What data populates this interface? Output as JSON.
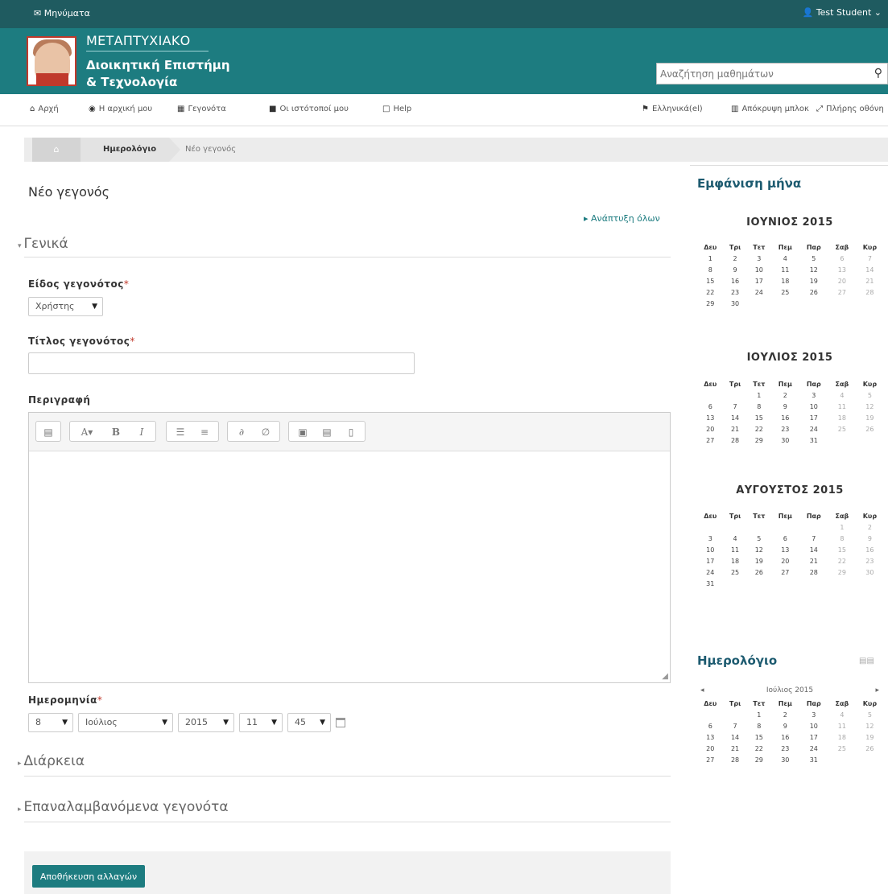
{
  "topbar": {
    "messages": "Μηνύματα",
    "user": "Test Student"
  },
  "header": {
    "line1": "ΜΕΤΑΠΤΥΧΙΑΚΟ",
    "line2": "Διοικητική Επιστήμη",
    "line3": "& Τεχνολογία",
    "search_placeholder": "Αναζήτηση μαθημάτων"
  },
  "nav": {
    "home": "Αρχή",
    "dashboard": "Η αρχική μου",
    "events": "Γεγονότα",
    "my_sites": "Οι ιστότοποί μου",
    "help": "Help",
    "language": "Ελληνικά(el)",
    "hide_blocks": "Απόκρυψη μπλοκ",
    "fullscreen": "Πλήρης οθόνη"
  },
  "breadcrumb": {
    "calendar": "Ημερολόγιο",
    "current": "Νέο γεγονός"
  },
  "main": {
    "title": "Νέο γεγονός",
    "expand_all": "Ανάπτυξη όλων",
    "general": "Γενικά",
    "event_type_label": "Είδος γεγονότος",
    "event_type_value": "Χρήστης",
    "event_title_label": "Τίτλος γεγονότος",
    "description_label": "Περιγραφή",
    "date_label": "Ημερομηνία",
    "duration": "Διάρκεια",
    "repeat": "Επαναλαμβανόμενα γεγονότα",
    "save": "Αποθήκευση αλλαγών",
    "required_mark": "*"
  },
  "date": {
    "day": "8",
    "month": "Ιούλιος",
    "year": "2015",
    "hour": "11",
    "minute": "45"
  },
  "sidebar": {
    "month_view_title": "Εμφάνιση μήνα",
    "calendar_title": "Ημερολόγιο",
    "small_month_name": "Ιούλιος 2015",
    "weekdays": [
      "Δευ",
      "Τρι",
      "Τετ",
      "Πεμ",
      "Παρ",
      "Σαβ",
      "Κυρ"
    ],
    "months": [
      {
        "title": "ΙΟΥΝΙΟΣ 2015",
        "weeks": [
          [
            "1",
            "2",
            "3",
            "4",
            "5",
            "6",
            "7"
          ],
          [
            "8",
            "9",
            "10",
            "11",
            "12",
            "13",
            "14"
          ],
          [
            "15",
            "16",
            "17",
            "18",
            "19",
            "20",
            "21"
          ],
          [
            "22",
            "23",
            "24",
            "25",
            "26",
            "27",
            "28"
          ],
          [
            "29",
            "30",
            "",
            "",
            "",
            "",
            ""
          ]
        ]
      },
      {
        "title": "ΙΟΥΛΙΟΣ 2015",
        "weeks": [
          [
            "",
            "",
            "1",
            "2",
            "3",
            "4",
            "5"
          ],
          [
            "6",
            "7",
            "8",
            "9",
            "10",
            "11",
            "12"
          ],
          [
            "13",
            "14",
            "15",
            "16",
            "17",
            "18",
            "19"
          ],
          [
            "20",
            "21",
            "22",
            "23",
            "24",
            "25",
            "26"
          ],
          [
            "27",
            "28",
            "29",
            "30",
            "31",
            "",
            ""
          ]
        ]
      },
      {
        "title": "ΑΥΓΟΥΣΤΟΣ 2015",
        "weeks": [
          [
            "",
            "",
            "",
            "",
            "",
            "1",
            "2"
          ],
          [
            "3",
            "4",
            "5",
            "6",
            "7",
            "8",
            "9"
          ],
          [
            "10",
            "11",
            "12",
            "13",
            "14",
            "15",
            "16"
          ],
          [
            "17",
            "18",
            "19",
            "20",
            "21",
            "22",
            "23"
          ],
          [
            "24",
            "25",
            "26",
            "27",
            "28",
            "29",
            "30"
          ],
          [
            "31",
            "",
            "",
            "",
            "",
            "",
            ""
          ]
        ]
      }
    ],
    "small_calendar": {
      "weeks": [
        [
          "",
          "",
          "1",
          "2",
          "3",
          "4",
          "5"
        ],
        [
          "6",
          "7",
          "8",
          "9",
          "10",
          "11",
          "12"
        ],
        [
          "13",
          "14",
          "15",
          "16",
          "17",
          "18",
          "19"
        ],
        [
          "20",
          "21",
          "22",
          "23",
          "24",
          "25",
          "26"
        ],
        [
          "27",
          "28",
          "29",
          "30",
          "31",
          "",
          ""
        ]
      ]
    }
  },
  "colors": {
    "teal": "#1d7c80",
    "dark_teal": "#1f5b60",
    "required": "#c0392b"
  }
}
